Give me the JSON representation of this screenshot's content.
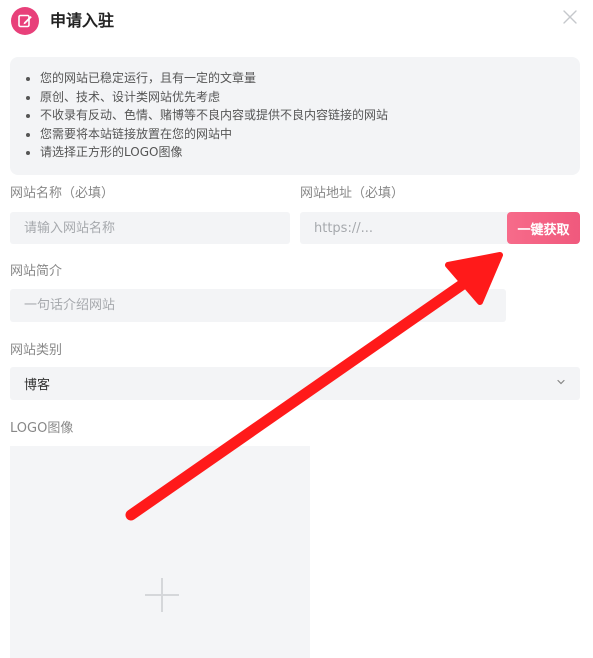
{
  "header": {
    "title": "申请入驻",
    "icon": "edit-icon",
    "accent_color": "#e8407a"
  },
  "notice": {
    "items": [
      "您的网站已稳定运行，且有一定的文章量",
      "原创、技术、设计类网站优先考虑",
      "不收录有反动、色情、赌博等不良内容或提供不良内容链接的网站",
      "您需要将本站链接放置在您的网站中",
      "请选择正方形的LOGO图像"
    ]
  },
  "form": {
    "site_name": {
      "label": "网站名称（必填）",
      "placeholder": "请输入网站名称",
      "value": ""
    },
    "site_url": {
      "label": "网站地址（必填）",
      "placeholder": "https://...",
      "value": "",
      "fetch_button_label": "一键获取"
    },
    "site_intro": {
      "label": "网站简介",
      "placeholder": "一句话介绍网站",
      "value": ""
    },
    "site_category": {
      "label": "网站类别",
      "selected": "博客"
    },
    "logo": {
      "label": "LOGO图像",
      "icon": "plus-icon"
    }
  },
  "annotation": {
    "type": "red-arrow",
    "color": "#ff1a1a",
    "points_to": "fetch-button"
  }
}
